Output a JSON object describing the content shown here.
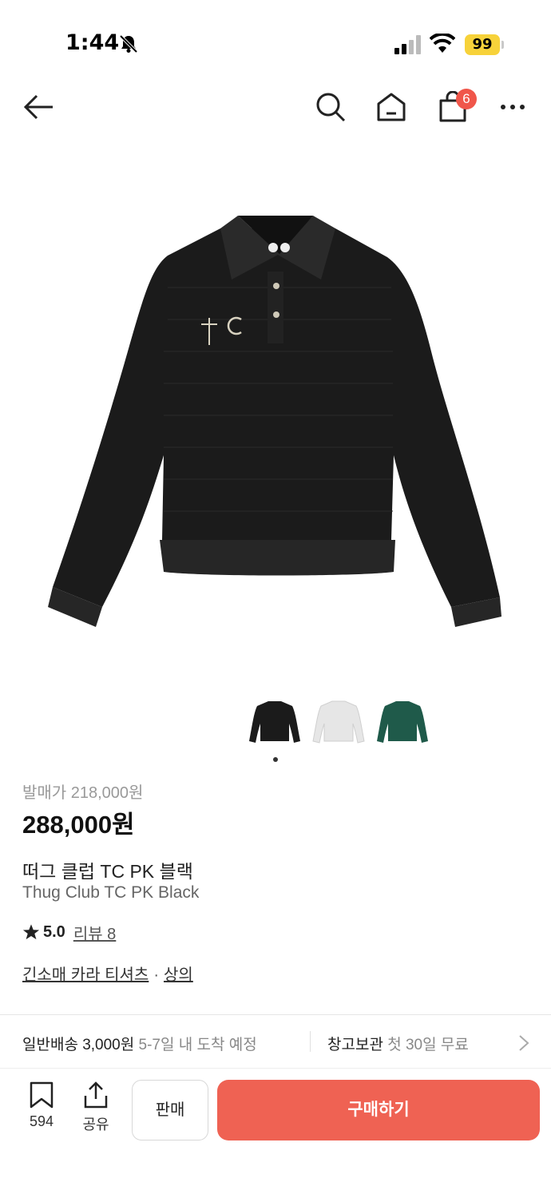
{
  "status_bar": {
    "time": "1:44",
    "battery": "99"
  },
  "nav": {
    "cart_count": "6"
  },
  "product": {
    "release_price": "발매가 218,000원",
    "price": "288,000원",
    "name_ko": "떠그 클럽 TC PK 블랙",
    "name_en": "Thug Club TC PK Black",
    "rating": "5.0",
    "review": "리뷰 8",
    "category_1": "긴소매 카라 티셔츠",
    "category_sep": "·",
    "category_2": "상의",
    "thumbnails": [
      "black",
      "white",
      "green"
    ]
  },
  "shipping": {
    "label": "일반배송 3,000원",
    "eta": "5-7일 내 도착 예정",
    "storage_label": "창고보관",
    "storage_note": "첫 30일 무료"
  },
  "bottom_bar": {
    "bookmark_count": "594",
    "share_label": "공유",
    "sell_label": "판매",
    "buy_label": "구매하기"
  },
  "colors": {
    "accent": "#ef6253",
    "badge": "#f0564a",
    "battery": "#f7d23a"
  }
}
